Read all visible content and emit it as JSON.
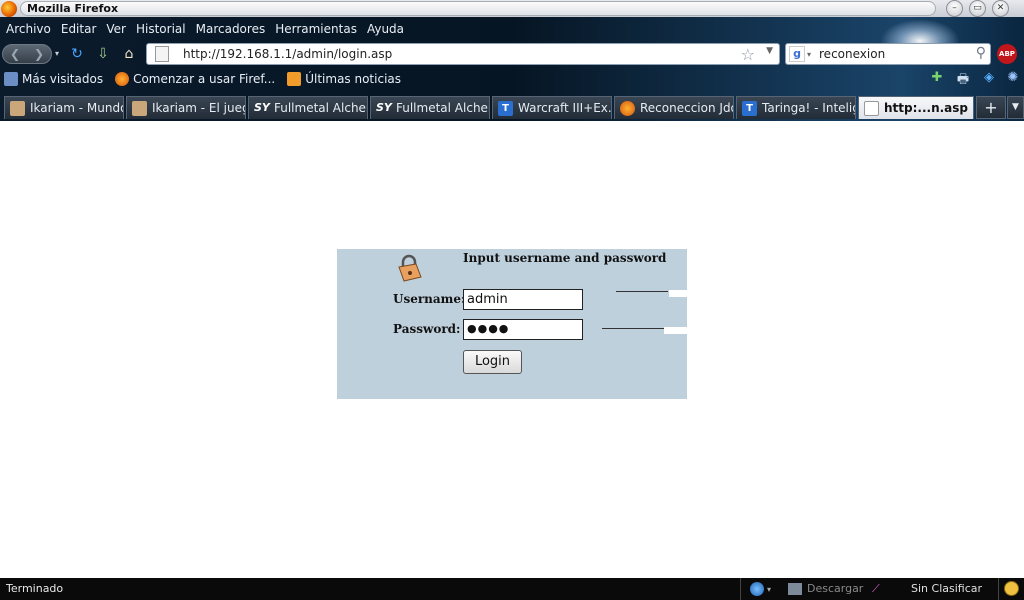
{
  "window": {
    "title": "Mozilla Firefox",
    "controls": [
      "–",
      "▭",
      "✕"
    ]
  },
  "menu": [
    "Archivo",
    "Editar",
    "Ver",
    "Historial",
    "Marcadores",
    "Herramientas",
    "Ayuda"
  ],
  "nav": {
    "url": "http://192.168.1.1/admin/login.asp",
    "search_text": "reconexion",
    "abp_label": "ABP"
  },
  "bookmarks": [
    "Más visitados",
    "Comenzar a usar Firef...",
    "Últimas noticias"
  ],
  "tabs": [
    {
      "label": "Ikariam - Mundo ...",
      "icon": "ikariam-icon"
    },
    {
      "label": "Ikariam - El jueg...",
      "icon": "ikariam-icon"
    },
    {
      "label": "Fullmetal Alchem...",
      "icon": "sy-icon"
    },
    {
      "label": "Fullmetal Alchem...",
      "icon": "sy-icon"
    },
    {
      "label": "Warcraft III+Ex...",
      "icon": "taringa-icon"
    },
    {
      "label": "Reconeccion Jdo...",
      "icon": "firefox-icon"
    },
    {
      "label": "Taringa! - Intelig...",
      "icon": "taringa-icon"
    },
    {
      "label": "http:...n.asp",
      "icon": "page-icon"
    }
  ],
  "login": {
    "heading": "Input username and password",
    "username_label": "Username:",
    "username_value": "admin",
    "password_label": "Password:",
    "password_value": "●●●●",
    "button_label": "Login"
  },
  "status": {
    "text": "Terminado",
    "download_label": "Descargar",
    "classification": "Sin Clasificar"
  }
}
